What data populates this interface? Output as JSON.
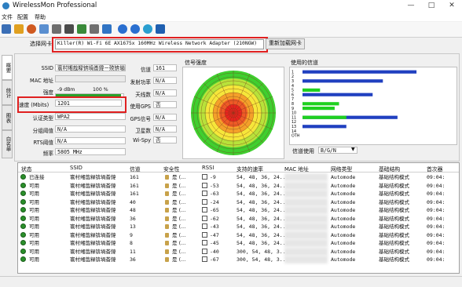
{
  "window": {
    "title": "WirelessMon Professional"
  },
  "menu": {
    "items": [
      "文件",
      "配置",
      "帮助"
    ]
  },
  "toolbar": {
    "icons": [
      "save-icon",
      "open-icon",
      "network-icon",
      "user-icon",
      "printer-icon",
      "monitor-icon",
      "export-icon",
      "settings-icon",
      "info-icon",
      "help-icon",
      "globe-icon",
      "refresh-icon"
    ]
  },
  "adapter": {
    "label": "选择网卡",
    "selected": "Killer(R) Wi-Fi 6E AX1675x 160MHz Wireless Network Adapter (210NGW)",
    "reload_button": "重新加载网卡",
    "highlight_color": "#e02020"
  },
  "left_tabs": [
    "概要",
    "统计",
    "图表",
    "白名单"
  ],
  "info": {
    "ssid_label": "SSID",
    "ssid_value": "寰村缃戠粶锛堝畨鍏ㄧ殑锛塴eh",
    "mac_label": "MAC 地址",
    "mac_value": "",
    "strength_label": "强度",
    "strength_min": "-9 dBm",
    "strength_max": "100 %",
    "speed_label": "速度 (Mbits)",
    "speed_value": "1201",
    "auth_label": "认证类型",
    "auth_value": "WPA2",
    "frag_label": "分组阈值",
    "frag_value": "N/A",
    "rts_label": "RTS阈值",
    "rts_value": "N/A",
    "freq_label": "频率",
    "freq_value": "5805 MHz",
    "channel_label": "信道",
    "channel_value": "161",
    "tx_label": "发射功率",
    "tx_value": "N/A",
    "antenna_label": "天线数",
    "antenna_value": "N/A",
    "gps_use_label": "使用GPS",
    "gps_use_value": "否",
    "gps_signal_label": "GPS信号",
    "gps_signal_value": "N/A",
    "sat_label": "卫星数",
    "sat_value": "N/A",
    "wispy_label": "Wi-Spy",
    "wispy_value": "否"
  },
  "signal_section": {
    "title": "信号强度"
  },
  "channel_section": {
    "title": "使用的信道",
    "channels": [
      {
        "ch": "1",
        "blue": 0.78,
        "green": 0.0
      },
      {
        "ch": "2",
        "blue": 0.0,
        "green": 0.0
      },
      {
        "ch": "3",
        "blue": 0.55,
        "green": 0.0
      },
      {
        "ch": "4",
        "blue": 0.0,
        "green": 0.0
      },
      {
        "ch": "5",
        "blue": 0.0,
        "green": 0.12
      },
      {
        "ch": "6",
        "blue": 0.48,
        "green": 0.0
      },
      {
        "ch": "7",
        "blue": 0.0,
        "green": 0.0
      },
      {
        "ch": "8",
        "blue": 0.0,
        "green": 0.25
      },
      {
        "ch": "9",
        "blue": 0.0,
        "green": 0.22
      },
      {
        "ch": "10",
        "blue": 0.0,
        "green": 0.0
      },
      {
        "ch": "11",
        "blue": 0.65,
        "green": 0.3
      },
      {
        "ch": "12",
        "blue": 0.0,
        "green": 0.0
      },
      {
        "ch": "13",
        "blue": 0.3,
        "green": 0.0
      },
      {
        "ch": "14",
        "blue": 0.0,
        "green": 0.0
      },
      {
        "ch": "OTH",
        "blue": 0.0,
        "green": 0.0
      }
    ],
    "usage_label": "信道使用",
    "usage_select": "B/G/N"
  },
  "table": {
    "headers": [
      "状态",
      "SSID",
      "信道",
      "安全性",
      "RSSI",
      "支持的速率",
      "MAC 地址",
      "网络类型",
      "基础结构",
      "首次器"
    ],
    "rows": [
      {
        "status": "已连接",
        "ssid": "寰村缃戠粶锛堝畨鍏",
        "ch": "161",
        "sec": "是 (...",
        "rssi": "-9",
        "rate": "54, 48, 36, 24...",
        "mac": "",
        "type": "Automode",
        "infra": "基础结构模式",
        "first": "09:04:"
      },
      {
        "status": "可用",
        "ssid": "寰村缃戠粶锛堝畨鍏",
        "ch": "161",
        "sec": "是 (...",
        "rssi": "-53",
        "rate": "54, 48, 36, 24...",
        "mac": "",
        "type": "Automode",
        "infra": "基础结构模式",
        "first": "09:04:"
      },
      {
        "status": "可用",
        "ssid": "寰村缃戠粶锛堝畨鍏",
        "ch": "161",
        "sec": "是 (...",
        "rssi": "-63",
        "rate": "54, 48, 36, 24...",
        "mac": "",
        "type": "Automode",
        "infra": "基础结构模式",
        "first": "09:04:"
      },
      {
        "status": "可用",
        "ssid": "寰村缃戠粶锛堝畨鍏",
        "ch": "40",
        "sec": "是 (...",
        "rssi": "-24",
        "rate": "54, 48, 36, 24...",
        "mac": "",
        "type": "Automode",
        "infra": "基础结构模式",
        "first": "09:04:"
      },
      {
        "status": "可用",
        "ssid": "寰村缃戠粶锛堝畨鍏",
        "ch": "48",
        "sec": "是 (...",
        "rssi": "-65",
        "rate": "54, 48, 36, 24...",
        "mac": "",
        "type": "Automode",
        "infra": "基础结构模式",
        "first": "09:04:"
      },
      {
        "status": "可用",
        "ssid": "寰村缃戠粶锛堝畨鍏",
        "ch": "36",
        "sec": "是 (...",
        "rssi": "-62",
        "rate": "54, 48, 36, 24...",
        "mac": "",
        "type": "Automode",
        "infra": "基础结构模式",
        "first": "09:04:"
      },
      {
        "status": "可用",
        "ssid": "寰村缃戠粶锛堝畨鍏",
        "ch": "13",
        "sec": "是 (...",
        "rssi": "-43",
        "rate": "54, 48, 36, 24...",
        "mac": "",
        "type": "Automode",
        "infra": "基础结构模式",
        "first": "09:04:"
      },
      {
        "status": "可用",
        "ssid": "寰村缃戠粶锛堝畨鍏",
        "ch": "9",
        "sec": "是 (...",
        "rssi": "-47",
        "rate": "54, 48, 36, 24...",
        "mac": "",
        "type": "Automode",
        "infra": "基础结构模式",
        "first": "09:04:"
      },
      {
        "status": "可用",
        "ssid": "寰村缃戠粶锛堝畨鍏",
        "ch": "8",
        "sec": "是 (...",
        "rssi": "-45",
        "rate": "54, 48, 36, 24...",
        "mac": "",
        "type": "Automode",
        "infra": "基础结构模式",
        "first": "09:04:"
      },
      {
        "status": "可用",
        "ssid": "寰村缃戠粶锛堝畨鍏",
        "ch": "11",
        "sec": "是 (...",
        "rssi": "-40",
        "rate": "300, 54, 48, 3...",
        "mac": "",
        "type": "Automode",
        "infra": "基础结构模式",
        "first": "09:04:"
      },
      {
        "status": "可用",
        "ssid": "寰村缃戠粶锛堝畨鍏",
        "ch": "36",
        "sec": "是 (...",
        "rssi": "-67",
        "rate": "300, 54, 48, 3...",
        "mac": "",
        "type": "Automode",
        "infra": "基础结构模式",
        "first": "09:04:"
      }
    ]
  },
  "colors": {
    "accent_blue": "#2040c0",
    "green": "#1fd01f",
    "status_green": "#2a8f2a"
  }
}
